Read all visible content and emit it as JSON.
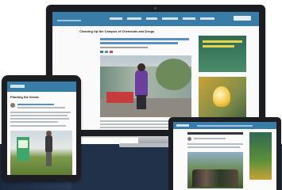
{
  "scene": {
    "background_color": "#ffffff",
    "band_color": "#22314a"
  },
  "monitor": {
    "site_header_color": "#3a7ca8",
    "logo_text": "",
    "article_title": "Cleaning Up the Campus of Chemicals and Drugs"
  },
  "tablet": {
    "article_title": "Planting the Seeds"
  },
  "laptop": {},
  "icons": [
    "camera-icon",
    "search-icon"
  ]
}
